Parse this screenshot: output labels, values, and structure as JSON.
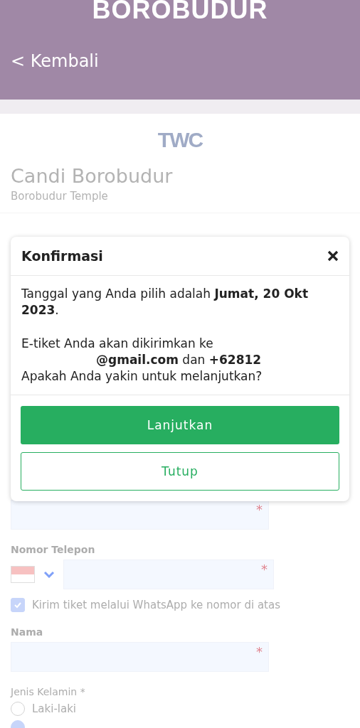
{
  "header": {
    "title": "BOROBUDUR",
    "back_link": "< Kembali"
  },
  "site": {
    "logo": "TWC",
    "title": "Candi Borobudur",
    "subtitle": "Borobudur Temple"
  },
  "form": {
    "fields": [
      {
        "kind": "text",
        "required_mark": "*"
      },
      {
        "kind": "label",
        "label": "Nomor Telepon"
      },
      {
        "kind": "phone",
        "required_mark": "*"
      },
      {
        "kind": "checkbox",
        "label": "Kirim tiket melalui WhatsApp ke nomor di atas",
        "checked": true
      },
      {
        "kind": "label",
        "label": "Nama"
      },
      {
        "kind": "text",
        "required_mark": "*"
      },
      {
        "kind": "hint",
        "label": "Jenis Kelamin *"
      },
      {
        "kind": "radio",
        "label": "Laki-laki",
        "selected": false
      },
      {
        "kind": "radio",
        "selected": true
      }
    ]
  },
  "dialog": {
    "title": "Konfirmasi",
    "paragraphs": [
      {
        "lines": [
          {
            "text": "Tanggal yang Anda pilih adalah **Jumat, 20 Okt 2023**."
          }
        ]
      },
      {
        "lines": [
          {
            "text": "E-tiket Anda akan dikirimkan ke"
          },
          {
            "text": "**@gmail.com** dan **+62812**",
            "redacted_prefix": true
          },
          {
            "text": "Apakah Anda yakin untuk melanjutkan?"
          }
        ]
      }
    ],
    "buttons": [
      {
        "label": "Lanjutkan",
        "kind": "primary"
      },
      {
        "label": "Tutup",
        "kind": "secondary"
      }
    ]
  }
}
